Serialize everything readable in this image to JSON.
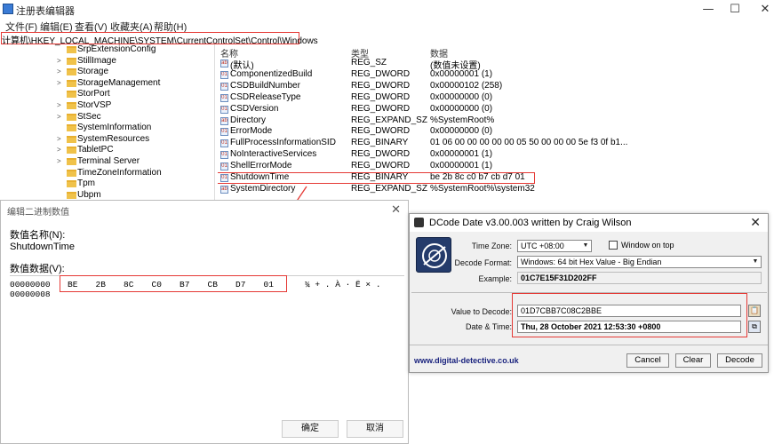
{
  "window": {
    "title": "注册表编辑器",
    "menu": [
      "文件(F)",
      "编辑(E)",
      "查看(V)",
      "收藏夹(A)",
      "帮助(H)"
    ],
    "controls": {
      "minimize": "—",
      "maximize": "☐",
      "close": "✕"
    }
  },
  "address": "计算机\\HKEY_LOCAL_MACHINE\\SYSTEM\\CurrentControlSet\\Control\\Windows",
  "tree": [
    {
      "label": "SrpExtensionConfig",
      "expandable": false
    },
    {
      "label": "StillImage",
      "expandable": true
    },
    {
      "label": "Storage",
      "expandable": true
    },
    {
      "label": "StorageManagement",
      "expandable": true
    },
    {
      "label": "StorPort",
      "expandable": false
    },
    {
      "label": "StorVSP",
      "expandable": true
    },
    {
      "label": "StSec",
      "expandable": true
    },
    {
      "label": "SystemInformation",
      "expandable": false
    },
    {
      "label": "SystemResources",
      "expandable": true
    },
    {
      "label": "TabletPC",
      "expandable": true
    },
    {
      "label": "Terminal Server",
      "expandable": true
    },
    {
      "label": "TimeZoneInformation",
      "expandable": false
    },
    {
      "label": "Tpm",
      "expandable": false
    },
    {
      "label": "Ubpm",
      "expandable": false
    }
  ],
  "list": {
    "headers": {
      "name": "名称",
      "type": "类型",
      "data": "数据"
    },
    "rows": [
      {
        "name": "(默认)",
        "type": "REG_SZ",
        "data": "(数值未设置)",
        "icon": "ab"
      },
      {
        "name": "ComponentizedBuild",
        "type": "REG_DWORD",
        "data": "0x00000001 (1)",
        "icon": "01"
      },
      {
        "name": "CSDBuildNumber",
        "type": "REG_DWORD",
        "data": "0x00000102 (258)",
        "icon": "01"
      },
      {
        "name": "CSDReleaseType",
        "type": "REG_DWORD",
        "data": "0x00000000 (0)",
        "icon": "01"
      },
      {
        "name": "CSDVersion",
        "type": "REG_DWORD",
        "data": "0x00000000 (0)",
        "icon": "01"
      },
      {
        "name": "Directory",
        "type": "REG_EXPAND_SZ",
        "data": "%SystemRoot%",
        "icon": "ab"
      },
      {
        "name": "ErrorMode",
        "type": "REG_DWORD",
        "data": "0x00000000 (0)",
        "icon": "01"
      },
      {
        "name": "FullProcessInformationSID",
        "type": "REG_BINARY",
        "data": "01 06 00 00 00 00 00 05 50 00 00 00 5e f3 0f b1...",
        "icon": "01"
      },
      {
        "name": "NoInteractiveServices",
        "type": "REG_DWORD",
        "data": "0x00000001 (1)",
        "icon": "01"
      },
      {
        "name": "ShellErrorMode",
        "type": "REG_DWORD",
        "data": "0x00000001 (1)",
        "icon": "01"
      },
      {
        "name": "ShutdownTime",
        "type": "REG_BINARY",
        "data": "be 2b 8c c0 b7 cb d7 01",
        "icon": "01"
      },
      {
        "name": "SystemDirectory",
        "type": "REG_EXPAND_SZ",
        "data": "%SystemRoot%\\system32",
        "icon": "ab"
      }
    ]
  },
  "binary_dialog": {
    "title": "编辑二进制数值",
    "name_label": "数值名称(N):",
    "name_value": "ShutdownTime",
    "data_label": "数值数据(V):",
    "offset1": "00000000",
    "bytes": [
      "BE",
      "2B",
      "8C",
      "C0",
      "B7",
      "CB",
      "D7",
      "01"
    ],
    "ascii": "¾ + . À · Ë × .",
    "offset2": "00000008",
    "ok": "确定",
    "cancel": "取消"
  },
  "dcode": {
    "title": "DCode Date  v3.00.003  written by Craig Wilson",
    "timezone_label": "Time Zone:",
    "timezone_value": "UTC +08:00",
    "window_on_top": "Window on top",
    "decode_format_label": "Decode Format:",
    "decode_format_value": "Windows: 64 bit Hex Value - Big Endian",
    "example_label": "Example:",
    "example_value": "01C7E15F31D202FF",
    "value_label": "Value to Decode:",
    "value_input": "01D7CBB7C08C2BBE",
    "datetime_label": "Date & Time:",
    "datetime_value": "Thu, 28 October 2021 12:53:30 +0800",
    "website": "www.digital-detective.co.uk",
    "cancel": "Cancel",
    "clear": "Clear",
    "decode": "Decode"
  }
}
